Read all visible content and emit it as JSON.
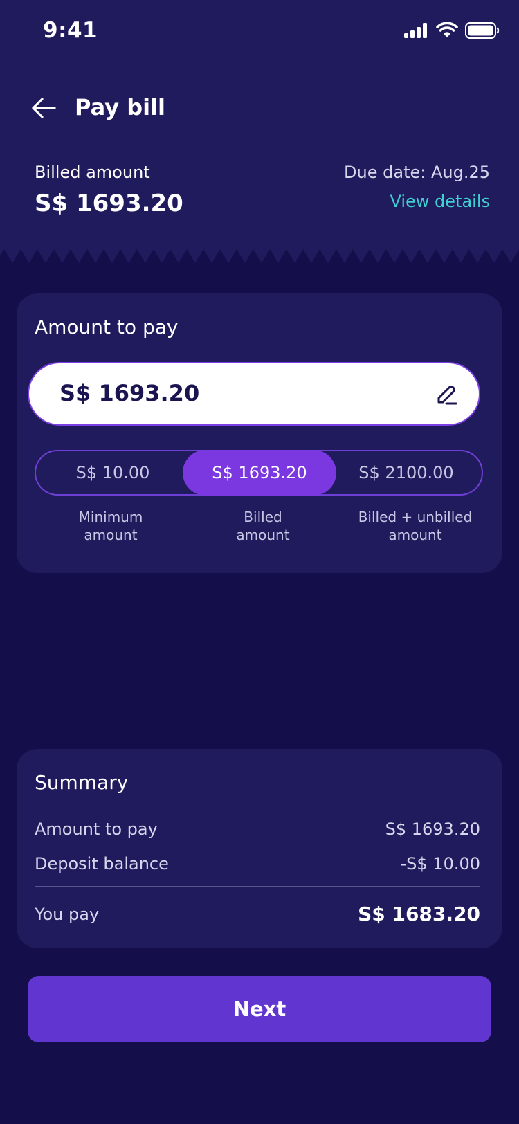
{
  "status": {
    "time": "9:41"
  },
  "nav": {
    "title": "Pay bill"
  },
  "bill": {
    "billed_label": "Billed amount",
    "billed_value": "S$ 1693.20",
    "due_date": "Due date: Aug.25",
    "view_details": "View details"
  },
  "amount": {
    "title": "Amount to pay",
    "input_value": "S$ 1693.20",
    "options": [
      {
        "value": "S$ 10.00",
        "caption": "Minimum\namount"
      },
      {
        "value": "S$ 1693.20",
        "caption": "Billed\namount",
        "selected": true
      },
      {
        "value": "S$ 2100.00",
        "caption": "Billed  + unbilled\namount"
      }
    ]
  },
  "summary": {
    "title": "Summary",
    "rows": [
      {
        "label": "Amount to pay",
        "value": "S$ 1693.20"
      },
      {
        "label": "Deposit balance",
        "value": "-S$ 10.00"
      }
    ],
    "total_label": "You pay",
    "total_value": "S$ 1683.20"
  },
  "next_button": "Next",
  "colors": {
    "background": "#140f4a",
    "card": "#201b5c",
    "accent": "#7c38e0",
    "button": "#6136d0",
    "link": "#3fd0d4"
  }
}
